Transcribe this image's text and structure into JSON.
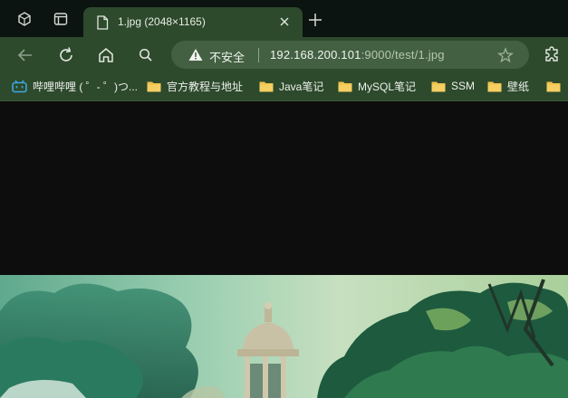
{
  "tab": {
    "title": "1.jpg (2048×1165)"
  },
  "address_bar": {
    "security_label": "不安全",
    "url_host": "192.168.200.101",
    "url_rest": ":9000/test/1.jpg"
  },
  "bookmarks": [
    {
      "label": "哔哩哔哩 ( ゜- ゜)つ...",
      "icon": "bilibili-icon"
    },
    {
      "label": "官方教程与地址",
      "icon": "folder-icon"
    },
    {
      "label": "Java笔记",
      "icon": "folder-icon"
    },
    {
      "label": "MySQL笔记",
      "icon": "folder-icon"
    },
    {
      "label": "SSM",
      "icon": "folder-icon"
    },
    {
      "label": "壁纸",
      "icon": "folder-icon"
    }
  ],
  "colors": {
    "tab_strip": "#0b1410",
    "toolbar": "#2d4a2c",
    "address_field": "#436142",
    "page_background": "#0d0d0d",
    "folder": "#f0c24a"
  }
}
